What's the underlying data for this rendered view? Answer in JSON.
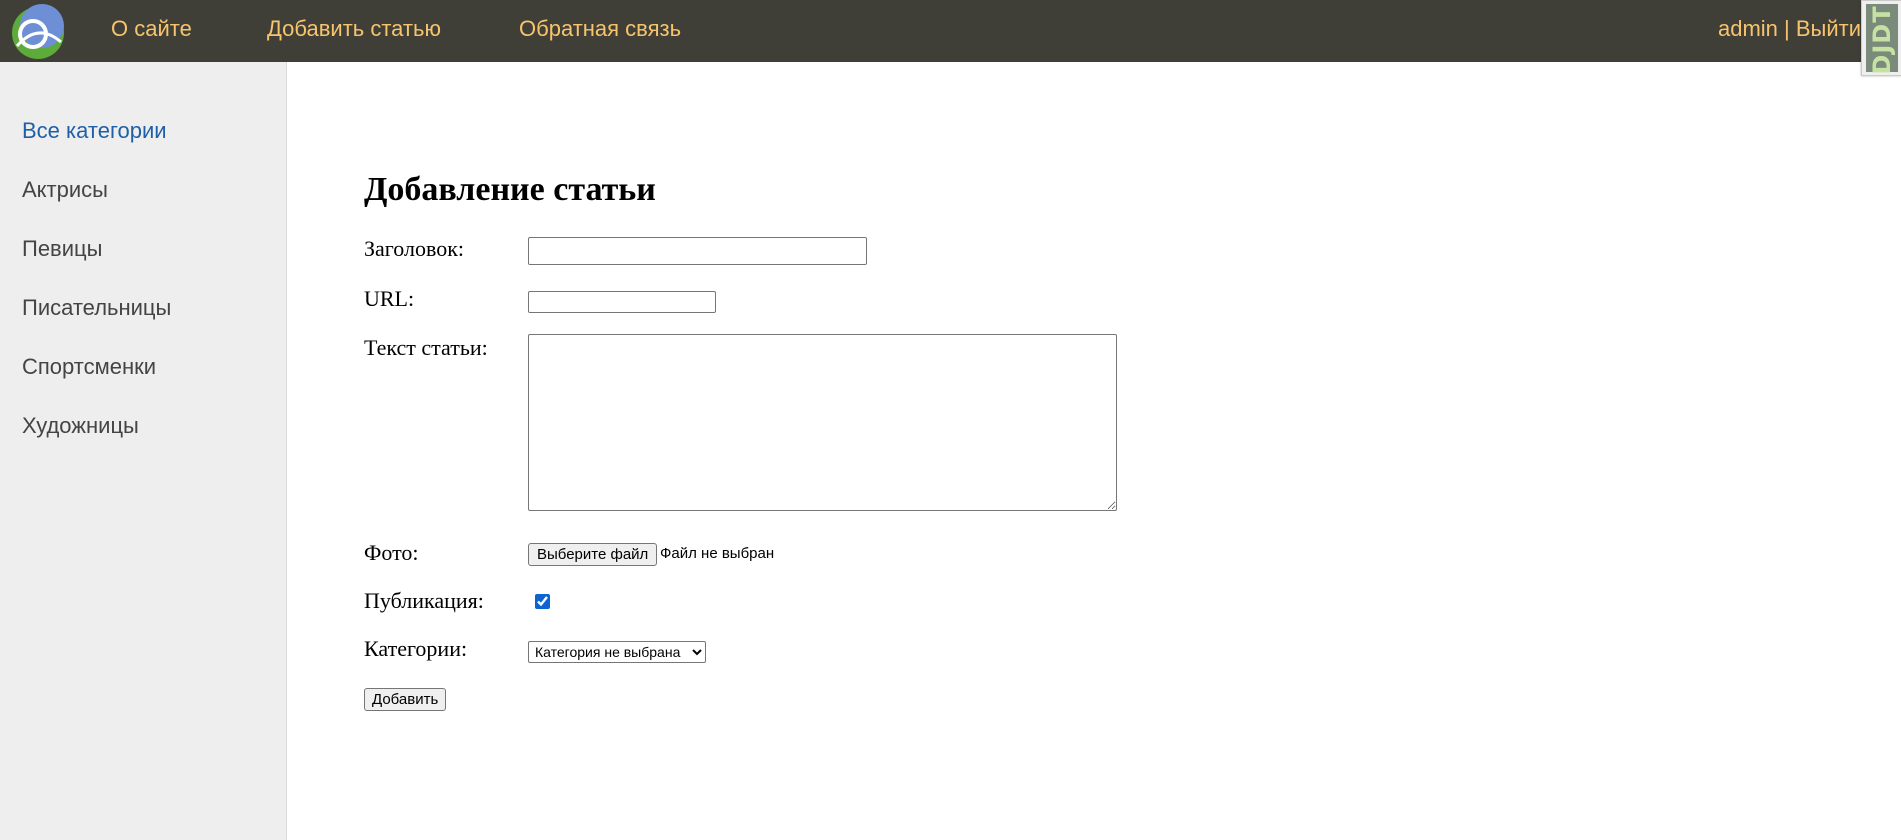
{
  "colors": {
    "topbar_bg": "#3f3f37",
    "nav_link": "#f7c46e",
    "sidebar_bg": "#eeeeee",
    "sidebar_active": "#1f5fa8",
    "sidebar_text": "#444444"
  },
  "header": {
    "logo_icon": "site-logo-icon",
    "nav": [
      {
        "label": "О сайте"
      },
      {
        "label": "Добавить статью"
      },
      {
        "label": "Обратная связь"
      }
    ],
    "user": {
      "name": "admin",
      "separator": " | ",
      "logout": "Выйти"
    },
    "debug_toolbar": {
      "label": "DJDT"
    }
  },
  "sidebar": {
    "items": [
      {
        "label": "Все категории",
        "active": true
      },
      {
        "label": "Актрисы"
      },
      {
        "label": "Певицы"
      },
      {
        "label": "Писательницы"
      },
      {
        "label": "Спортсменки"
      },
      {
        "label": "Художницы"
      }
    ]
  },
  "form": {
    "title": "Добавление статьи",
    "fields": {
      "title": {
        "label": "Заголовок:",
        "value": ""
      },
      "url": {
        "label": "URL:",
        "value": ""
      },
      "content": {
        "label": "Текст статьи:",
        "value": ""
      },
      "photo": {
        "label": "Фото:",
        "button": "Выберите файл",
        "status": "Файл не выбран"
      },
      "published": {
        "label": "Публикация:",
        "checked": true
      },
      "category": {
        "label": "Категории:",
        "selected": "Категория не выбрана"
      }
    },
    "submit": "Добавить"
  }
}
